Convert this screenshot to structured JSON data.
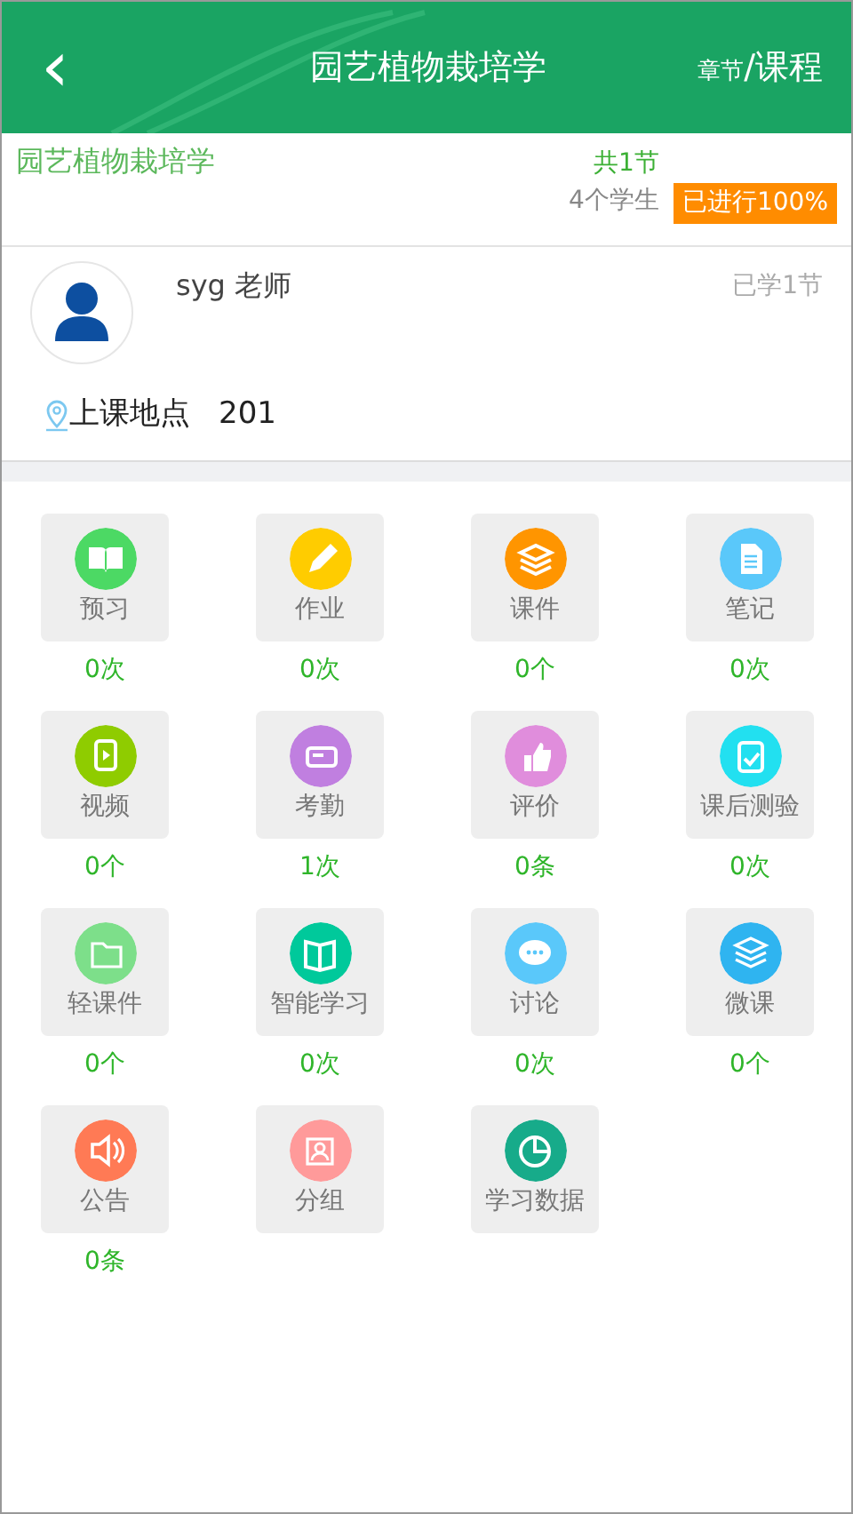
{
  "header": {
    "back": "‹",
    "title": "园艺植物栽培学",
    "views": [
      {
        "label": "章节",
        "selected": false
      },
      {
        "label": "/课程",
        "selected": true
      }
    ]
  },
  "course": {
    "name": "园艺植物栽培学",
    "sections": "共1节",
    "students": "4个学生",
    "progress": "已进行100%"
  },
  "teacher": {
    "name": "syg 老师",
    "studied": "已学1节",
    "location_label": "上课地点",
    "location": "201"
  },
  "tools": [
    {
      "label": "预习",
      "count": "0次",
      "color": "#4cd964"
    },
    {
      "label": "作业",
      "count": "0次",
      "color": "#ffcc00"
    },
    {
      "label": "课件",
      "count": "0个",
      "color": "#ff9500"
    },
    {
      "label": "笔记",
      "count": "0次",
      "color": "#5ac8fa"
    },
    {
      "label": "视频",
      "count": "0个",
      "color": "#8fcc00"
    },
    {
      "label": "考勤",
      "count": "1次",
      "color": "#c07fe0"
    },
    {
      "label": "评价",
      "count": "0条",
      "color": "#e08ddc"
    },
    {
      "label": "课后测验",
      "count": "0次",
      "color": "#22e0f0"
    },
    {
      "label": "轻课件",
      "count": "0个",
      "color": "#7ddf8a"
    },
    {
      "label": "智能学习",
      "count": "0次",
      "color": "#00c99b"
    },
    {
      "label": "讨论",
      "count": "0次",
      "color": "#5ac8fa"
    },
    {
      "label": "微课",
      "count": "0个",
      "color": "#2fb4f0"
    },
    {
      "label": "公告",
      "count": "0条",
      "color": "#ff7a55"
    },
    {
      "label": "分组",
      "color": "#ff9a9a"
    },
    {
      "label": "学习数据",
      "color": "#17ab8a"
    }
  ]
}
